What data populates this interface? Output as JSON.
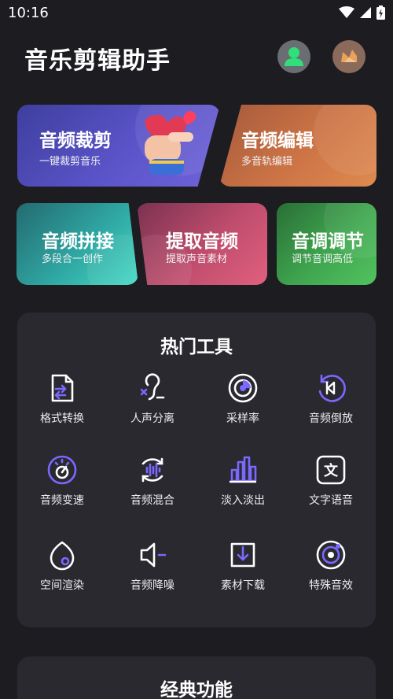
{
  "status": {
    "time": "10:16"
  },
  "header": {
    "title": "音乐剪辑助手"
  },
  "cards": {
    "cut": {
      "title": "音频裁剪",
      "subtitle": "一键裁剪音乐"
    },
    "edit": {
      "title": "音频编辑",
      "subtitle": "多音轨编辑"
    },
    "join": {
      "title": "音频拼接",
      "subtitle": "多段合一创作"
    },
    "extract": {
      "title": "提取音频",
      "subtitle": "提取声音素材"
    },
    "pitch": {
      "title": "音调调节",
      "subtitle": "调节音调高低"
    }
  },
  "hot_tools": {
    "title": "热门工具",
    "items": [
      {
        "label": "格式转换",
        "icon": "file-convert-icon"
      },
      {
        "label": "人声分离",
        "icon": "vocal-separate-icon"
      },
      {
        "label": "采样率",
        "icon": "sample-rate-icon"
      },
      {
        "label": "音频倒放",
        "icon": "reverse-play-icon"
      },
      {
        "label": "音频变速",
        "icon": "speed-icon"
      },
      {
        "label": "音频混合",
        "icon": "mix-icon"
      },
      {
        "label": "淡入淡出",
        "icon": "fade-icon"
      },
      {
        "label": "文字语音",
        "icon": "text-to-speech-icon"
      },
      {
        "label": "空间渲染",
        "icon": "spatial-render-icon"
      },
      {
        "label": "音频降噪",
        "icon": "denoise-icon"
      },
      {
        "label": "素材下载",
        "icon": "download-icon"
      },
      {
        "label": "特殊音效",
        "icon": "special-effect-icon"
      }
    ]
  },
  "classic": {
    "title": "经典功能"
  },
  "colors": {
    "accent": "#6c5ce7",
    "icon_stroke": "#ffffff",
    "background": "#1d1c21",
    "panel": "#2a292f"
  }
}
